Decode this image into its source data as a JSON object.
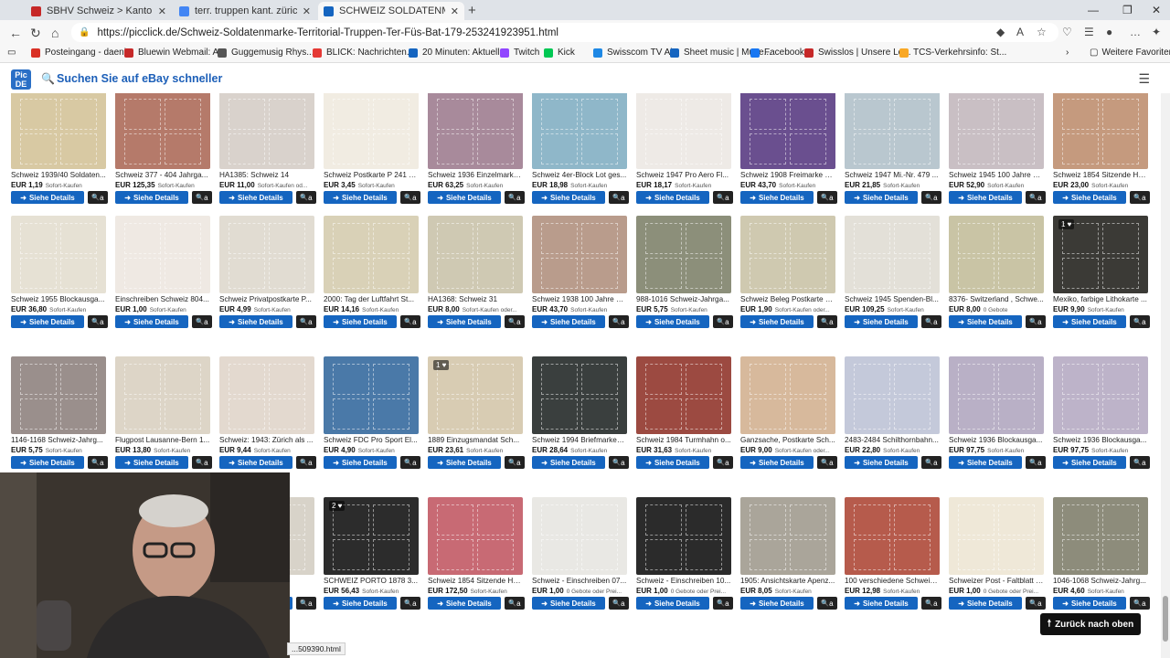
{
  "tabs": [
    {
      "title": "SBHV Schweiz > Kantonal- und Fe",
      "color": "#c62828"
    },
    {
      "title": "terr. truppen kant. zürich briefma",
      "color": "#4285f4"
    },
    {
      "title": "SCHWEIZ SOLDATENMARKE TERR",
      "color": "#1565c0"
    }
  ],
  "url": "https://picclick.de/Schweiz-Soldatenmarke-Territorial-Truppen-Ter-Füs-Bat-179-253241923951.html",
  "bookmarks": [
    {
      "label": "Posteingang - daeni...",
      "color": "#d93025"
    },
    {
      "label": "Bluewin Webmail: A...",
      "color": "#c62828"
    },
    {
      "label": "Guggemusig Rhys...",
      "color": "#555555"
    },
    {
      "label": "BLICK: Nachrichten...",
      "color": "#e53935"
    },
    {
      "label": "20 Minuten: Aktuell...",
      "color": "#1565c0"
    },
    {
      "label": "Twitch",
      "color": "#9146ff"
    },
    {
      "label": "Kick",
      "color": "#00c853"
    },
    {
      "label": "Swisscom TV Air",
      "color": "#1e88e5"
    },
    {
      "label": "Sheet music | Muse...",
      "color": "#1565c0"
    },
    {
      "label": "Facebook",
      "color": "#1877f2"
    },
    {
      "label": "Swisslos | Unsere Lo...",
      "color": "#c62828"
    },
    {
      "label": "TCS-Verkehrsinfo: St...",
      "color": "#f9a825"
    }
  ],
  "other_favorites": "Weitere Favoriten",
  "site": {
    "logo": "Pic DE",
    "search_label": "Suchen Sie auf eBay schneller"
  },
  "buttons": {
    "details": "Siehe Details",
    "zoom": "a"
  },
  "rows": [
    [
      {
        "title": "Schweiz 1939/40 Soldaten...",
        "price": "EUR 1,19",
        "status": "Sofort-Kaufen",
        "color": "#d8c9a3"
      },
      {
        "title": "Schweiz 377 - 404 Jahrga...",
        "price": "EUR 125,35",
        "status": "Sofort-Kaufen",
        "color": "#b57a6a"
      },
      {
        "title": "HA1385: Schweiz 14",
        "price": "EUR 11,00",
        "status": "Sofort-Kaufen od...",
        "color": "#d9d2cc"
      },
      {
        "title": "Schweiz Postkarte P 241 L...",
        "price": "EUR 3,45",
        "status": "Sofort-Kaufen",
        "color": "#f1ece2"
      },
      {
        "title": "Schweiz 1936 Einzelmarke...",
        "price": "EUR 63,25",
        "status": "Sofort-Kaufen",
        "color": "#a88a9b"
      },
      {
        "title": "Schweiz 4er-Block Lot ges...",
        "price": "EUR 18,98",
        "status": "Sofort-Kaufen",
        "color": "#8fb7c9"
      },
      {
        "title": "Schweiz 1947 Pro Aero Fl...",
        "price": "EUR 18,17",
        "status": "Sofort-Kaufen",
        "color": "#eeeae6"
      },
      {
        "title": "Schweiz 1908 Freimarke S...",
        "price": "EUR 43,70",
        "status": "Sofort-Kaufen",
        "color": "#6a4f8f"
      },
      {
        "title": "Schweiz 1947 Mi.-Nr. 479 ...",
        "price": "EUR 21,85",
        "status": "Sofort-Kaufen",
        "color": "#b9c7cf"
      },
      {
        "title": "Schweiz 1945 100 Jahre B...",
        "price": "EUR 52,90",
        "status": "Sofort-Kaufen",
        "color": "#c9bfc4"
      },
      {
        "title": "Schweiz 1854 Sitzende He...",
        "price": "EUR 23,00",
        "status": "Sofort-Kaufen",
        "color": "#c59a7e"
      }
    ],
    [
      {
        "title": "Schweiz 1955 Blockausga...",
        "price": "EUR 36,80",
        "status": "Sofort-Kaufen",
        "color": "#e6e1d4"
      },
      {
        "title": "Einschreiben Schweiz 804...",
        "price": "EUR 1,00",
        "status": "Sofort-Kaufen",
        "color": "#efe9e3"
      },
      {
        "title": "Schweiz Privatpostkarte P...",
        "price": "EUR 4,99",
        "status": "Sofort-Kaufen",
        "color": "#e1dcd2"
      },
      {
        "title": "2000: Tag der Luftfahrt St...",
        "price": "EUR 14,16",
        "status": "Sofort-Kaufen",
        "color": "#d9d1b7"
      },
      {
        "title": "HA1368: Schweiz 31",
        "price": "EUR 8,00",
        "status": "Sofort-Kaufen oder...",
        "color": "#cfc9b3"
      },
      {
        "title": "Schweiz 1938 100 Jahre S...",
        "price": "EUR 43,70",
        "status": "Sofort-Kaufen",
        "color": "#b99c8c"
      },
      {
        "title": "988-1016 Schweiz-Jahrga...",
        "price": "EUR 5,75",
        "status": "Sofort-Kaufen",
        "color": "#8c8f7a"
      },
      {
        "title": "Schweiz Beleg Postkarte a...",
        "price": "EUR 1,90",
        "status": "Sofort-Kaufen oder...",
        "color": "#cfc9b0"
      },
      {
        "title": "Schweiz 1945 Spenden-Bl...",
        "price": "EUR 109,25",
        "status": "Sofort-Kaufen",
        "color": "#e3e0d8"
      },
      {
        "title": "8376- Switzerland , Schwe...",
        "price": "EUR 8,00",
        "status": "0 Gebote",
        "color": "#c9c4a5"
      },
      {
        "title": "Mexiko, farbige Lithokarte ...",
        "price": "EUR 9,90",
        "status": "Sofort-Kaufen",
        "color": "#3b3a36"
      }
    ],
    [
      {
        "title": "1146-1168 Schweiz-Jahrg...",
        "price": "EUR 5,75",
        "status": "Sofort-Kaufen",
        "color": "#9a8f8c"
      },
      {
        "title": "Flugpost Lausanne-Bern 1...",
        "price": "EUR 13,80",
        "status": "Sofort-Kaufen",
        "color": "#ddd5c7"
      },
      {
        "title": "Schweiz: 1943: Zürich als ...",
        "price": "EUR 9,44",
        "status": "Sofort-Kaufen",
        "color": "#e3d9cf"
      },
      {
        "title": "Schweiz FDC Pro Sport El...",
        "price": "EUR 4,90",
        "status": "Sofort-Kaufen",
        "color": "#4a79a8"
      },
      {
        "title": "1889 Einzugsmandat Sch...",
        "price": "EUR 23,61",
        "status": "Sofort-Kaufen",
        "color": "#d8ccb3"
      },
      {
        "title": "Schweiz 1994 Briefmarken...",
        "price": "EUR 28,64",
        "status": "Sofort-Kaufen",
        "color": "#3a3f3e"
      },
      {
        "title": "Schweiz 1984 Turmhahn o...",
        "price": "EUR 31,63",
        "status": "Sofort-Kaufen",
        "color": "#9c4a41"
      },
      {
        "title": "Ganzsache, Postkarte Sch...",
        "price": "EUR 9,00",
        "status": "Sofort-Kaufen oder...",
        "color": "#d7b99c"
      },
      {
        "title": "2483-2484 Schilthornbahn...",
        "price": "EUR 22,80",
        "status": "Sofort-Kaufen",
        "color": "#c4c9da"
      },
      {
        "title": "Schweiz 1936 Blockausga...",
        "price": "EUR 97,75",
        "status": "Sofort-Kaufen",
        "color": "#b9b0c6"
      },
      {
        "title": "Schweiz 1936 Blockausga...",
        "price": "EUR 97,75",
        "status": "Sofort-Kaufen",
        "color": "#bdb3c9"
      }
    ],
    [
      {
        "title": "...29 T...",
        "price": "",
        "status": "",
        "color": "#d8d3c9"
      },
      {
        "title": "SCHWEIZ PORTO 1878 3...",
        "price": "EUR 56,43",
        "status": "Sofort-Kaufen",
        "color": "#2c2c2c"
      },
      {
        "title": "Schweiz 1854 Sitzende He...",
        "price": "EUR 172,50",
        "status": "Sofort-Kaufen",
        "color": "#c86a74"
      },
      {
        "title": "Schweiz - Einschreiben 07...",
        "price": "EUR 1,00",
        "status": "0 Gebote oder Prei...",
        "color": "#e9e8e4"
      },
      {
        "title": "Schweiz - Einschreiben 10...",
        "price": "EUR 1,00",
        "status": "0 Gebote oder Prei...",
        "color": "#2b2b2b"
      },
      {
        "title": "1905: Ansichtskarte Apenz...",
        "price": "EUR 8,05",
        "status": "Sofort-Kaufen",
        "color": "#aaa59a"
      },
      {
        "title": "100 verschiedene Schweiz...",
        "price": "EUR 12,98",
        "status": "Sofort-Kaufen",
        "color": "#b65b4c"
      },
      {
        "title": "Schweizer Post - Faltblatt \"...",
        "price": "EUR 1,00",
        "status": "0 Gebote oder Prei...",
        "color": "#efe8d8"
      },
      {
        "title": "1046-1068 Schweiz-Jahrg...",
        "price": "EUR 4,60",
        "status": "Sofort-Kaufen",
        "color": "#8d8c7b"
      }
    ]
  ],
  "badges": [
    {
      "text": "1 ♥",
      "row": 1,
      "col": 10
    },
    {
      "text": "1 ♥",
      "row": 2,
      "col": 4
    },
    {
      "text": "2 ♥",
      "row": 3,
      "col": 1
    }
  ],
  "status_url": "...509390.html",
  "back_to_top": "Zurück nach oben"
}
